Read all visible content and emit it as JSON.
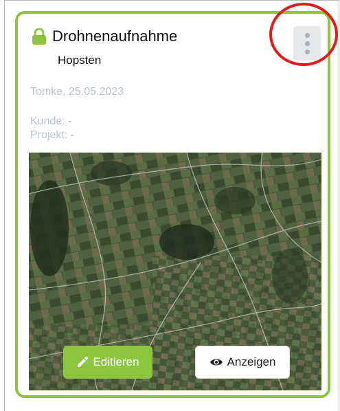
{
  "card": {
    "title": "Drohnenaufnahme",
    "location": "Hopsten",
    "author_date": "Tomke, 25.05.2023",
    "kunde_label": "Kunde:",
    "kunde_value": "-",
    "projekt_label": "Projekt:",
    "projekt_value": "-",
    "map_alt": "Luftbild Karte",
    "accent_color": "#8cc63f",
    "annotation_color": "#e3191b"
  },
  "actions": {
    "edit_label": "Editieren",
    "view_label": "Anzeigen"
  },
  "icons": {
    "lock": "lock-icon",
    "menu": "more-vertical-icon",
    "pencil": "pencil-icon",
    "eye": "eye-icon"
  }
}
